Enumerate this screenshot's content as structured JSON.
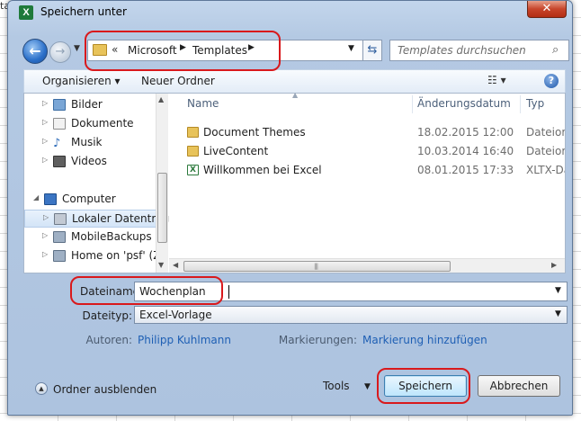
{
  "background_text": "ta",
  "dialog": {
    "title": "Speichern unter",
    "app_icon_letter": "X",
    "close_symbol": "✕"
  },
  "address": {
    "chevron": "«",
    "segments": [
      "Microsoft",
      "Templates"
    ],
    "search_placeholder": "Templates durchsuchen"
  },
  "toolbar": {
    "organize": "Organisieren ▾",
    "new_folder": "Neuer Ordner",
    "view": "☷ ▾",
    "help": "?"
  },
  "nav_items": [
    {
      "label": "Bilder"
    },
    {
      "label": "Dokumente"
    },
    {
      "label": "Musik"
    },
    {
      "label": "Videos"
    },
    {
      "label": "Computer"
    },
    {
      "label": "Lokaler Datenträg"
    },
    {
      "label": "MobileBackups o"
    },
    {
      "label": "Home on 'psf' (Z"
    }
  ],
  "columns": {
    "name": "Name",
    "date": "Änderungsdatum",
    "type": "Typ"
  },
  "files": [
    {
      "name": "Document Themes",
      "date": "18.02.2015 12:00",
      "type": "Dateiordn"
    },
    {
      "name": "LiveContent",
      "date": "10.03.2014 16:40",
      "type": "Dateiordn"
    },
    {
      "name": "Willkommen bei Excel",
      "date": "08.01.2015 17:33",
      "type": "XLTX-Dat"
    }
  ],
  "form": {
    "filename_label": "Dateiname:",
    "filename_value": "Wochenplan",
    "filetype_label": "Dateityp:",
    "filetype_value": "Excel-Vorlage",
    "authors_label": "Autoren:",
    "authors_value": "Philipp Kuhlmann",
    "tags_label": "Markierungen:",
    "tags_value": "Markierung hinzufügen"
  },
  "footer": {
    "hide_folders": "Ordner ausblenden",
    "tools": "Tools",
    "save": "Speichern",
    "cancel": "Abbrechen"
  }
}
